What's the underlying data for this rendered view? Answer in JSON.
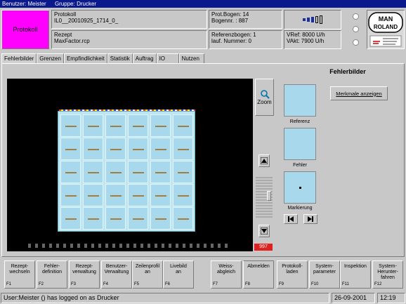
{
  "titlebar": {
    "user": "Benutzer: Meister",
    "group": "Gruppe: Drucker"
  },
  "header": {
    "protokoll_button": "Protokoll",
    "protokoll_label": "Protokoll",
    "protokoll_value": "IL0__20010925_1714_0_",
    "rezept_label": "Rezept",
    "rezept_value": "MaxFactor.rcp",
    "prot_bogen": "Prot.Bogen: 14",
    "bogennr": "Bogennr. : 887",
    "referenzbogen": "Referenzbogen: 1",
    "lauf_nummer": "lauf. Nummer: 0",
    "vref": "VRef: 8000 U/h",
    "vakt": "VAkt: 7900 U/h",
    "logo_top": "MAN ROLAND"
  },
  "tabs": [
    "Fehlerbilder",
    "Grenzen",
    "Empfindlichkeit",
    "Statistik",
    "Auftrag",
    "IO",
    "Nutzen"
  ],
  "panel": {
    "title": "Fehlerbilder",
    "zoom_label": "Zoom",
    "counter": "997",
    "merkmale_button": "Merkmale anzeigen",
    "thumb_labels": [
      "Referenz",
      "Fehler",
      "Markierung"
    ]
  },
  "fkeys": [
    {
      "label": "Rezept-\nwechseln",
      "key": "F1"
    },
    {
      "label": "Fehler-\ndefinition",
      "key": "F2"
    },
    {
      "label": "Rezept-\nverwaltung",
      "key": "F3"
    },
    {
      "label": "Benutzer-\nVerwaltung",
      "key": "F4"
    },
    {
      "label": "Zeilenprofil\nan",
      "key": "F5"
    },
    {
      "label": "Livebild\nan",
      "key": "F6"
    },
    {
      "label": "Weiss-\nabgleich",
      "key": "F7"
    },
    {
      "label": "Abmelden",
      "key": "F8"
    },
    {
      "label": "Protokoll-\nladen",
      "key": "F9"
    },
    {
      "label": "System-\nparameter",
      "key": "F10"
    },
    {
      "label": "Inspektion",
      "key": "F11"
    },
    {
      "label": "System-\nHerunter-\nfahren",
      "key": "F12"
    }
  ],
  "statusbar": {
    "message": "User:Meister () has logged on as Drucker",
    "date": "26-09-2001",
    "time": "12:19"
  },
  "colors": {
    "title_bg": "#0a1a8c",
    "protokoll_bg": "#ff00ff",
    "sheet": "#a7d8ec",
    "counter_bg": "#e02020"
  }
}
